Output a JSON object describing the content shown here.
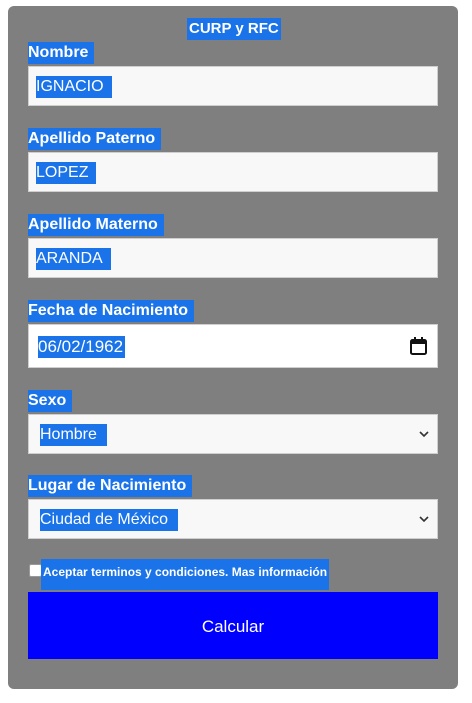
{
  "form": {
    "title": "CURP y RFC",
    "fields": {
      "nombre": {
        "label": "Nombre",
        "value": "IGNACIO"
      },
      "apellido_paterno": {
        "label": "Apellido Paterno",
        "value": "LOPEZ"
      },
      "apellido_materno": {
        "label": "Apellido Materno",
        "value": "ARANDA"
      },
      "fecha_nacimiento": {
        "label": "Fecha de Nacimiento",
        "value": "06/02/1962",
        "icon": "calendar-icon"
      },
      "sexo": {
        "label": "Sexo",
        "value": "Hombre",
        "icon": "chevron-down-icon"
      },
      "lugar_nacimiento": {
        "label": "Lugar de Nacimiento",
        "value": "Ciudad de México",
        "icon": "chevron-down-icon"
      }
    },
    "terms_label": "Aceptar terminos y condiciones. Mas información",
    "submit_label": "Calcular"
  },
  "colors": {
    "panel": "#7f7f7f",
    "selection": "#1a73e8",
    "button": "#0000ff"
  }
}
